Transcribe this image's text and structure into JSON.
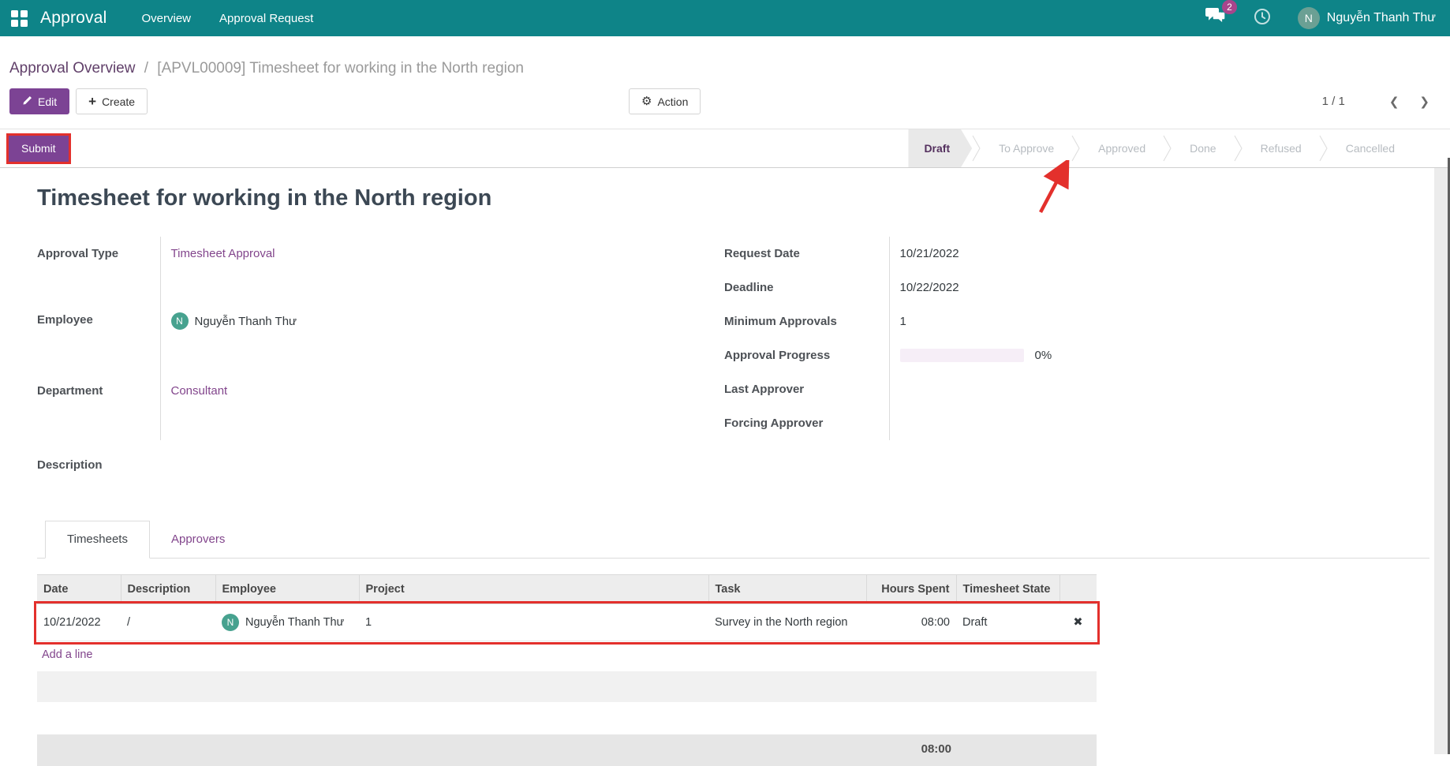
{
  "navbar": {
    "app_name": "Approval",
    "menu": [
      "Overview",
      "Approval Request"
    ],
    "messages_badge": "2",
    "user": {
      "initial": "N",
      "name": "Nguyễn Thanh Thư"
    }
  },
  "breadcrumb": {
    "parent": "Approval Overview",
    "separator": "/",
    "current": "[APVL00009] Timesheet for working in the North region"
  },
  "control_panel": {
    "edit": "Edit",
    "create": "Create",
    "action": "Action",
    "pager": {
      "value": "1 / 1",
      "prev": "❮",
      "next": "❯"
    }
  },
  "statusbar": {
    "submit": "Submit",
    "steps": [
      {
        "label": "Draft",
        "active": true
      },
      {
        "label": "To Approve",
        "active": false
      },
      {
        "label": "Approved",
        "active": false
      },
      {
        "label": "Done",
        "active": false
      },
      {
        "label": "Refused",
        "active": false
      },
      {
        "label": "Cancelled",
        "active": false
      }
    ]
  },
  "form": {
    "title": "Timesheet for working in the North region",
    "left_fields": [
      {
        "label": "Approval Type",
        "value": "Timesheet Approval"
      },
      {
        "label": "Employee",
        "value": "Nguyễn Thanh Thư",
        "avatar_initial": "N"
      },
      {
        "label": "Department",
        "value": "Consultant"
      }
    ],
    "right_fields": [
      {
        "label": "Request Date",
        "value": "10/21/2022"
      },
      {
        "label": "Deadline",
        "value": "10/22/2022"
      },
      {
        "label": "Minimum Approvals",
        "value": "1"
      },
      {
        "label": "Approval Progress",
        "value": "0%",
        "progress_percent": 0
      },
      {
        "label": "Last Approver",
        "value": ""
      },
      {
        "label": "Forcing Approver",
        "value": ""
      }
    ],
    "description_label": "Description"
  },
  "tabs": [
    {
      "label": "Timesheets",
      "active": true
    },
    {
      "label": "Approvers",
      "active": false
    }
  ],
  "timesheets": {
    "columns": [
      "Date",
      "Description",
      "Employee",
      "Project",
      "Task",
      "Hours Spent",
      "Timesheet State"
    ],
    "rows": [
      {
        "date": "10/21/2022",
        "description": "/",
        "employee_initial": "N",
        "employee": "Nguyễn Thanh Thư",
        "project": "1",
        "task": "Survey in the North region",
        "hours_spent": "08:00",
        "state": "Draft",
        "delete_glyph": "✖"
      }
    ],
    "add_line": "Add a line",
    "total_hours": "08:00"
  },
  "colors": {
    "navbar_teal": "#0e8488",
    "primary_purple": "#7c4394",
    "link_purple": "#82458c",
    "annotation_red": "#e3302c",
    "avatar_green": "#47a28f",
    "badge_magenta": "#a8458c"
  }
}
